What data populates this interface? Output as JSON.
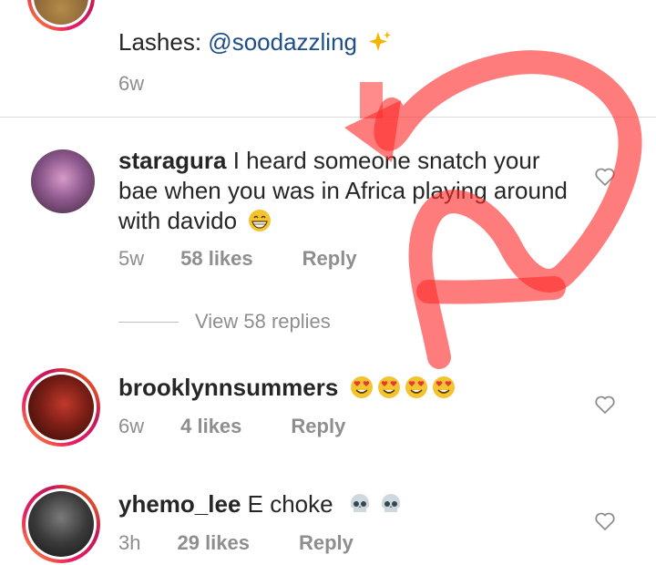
{
  "comments": [
    {
      "text_prefix": "Lashes: ",
      "mention": "@soodazzling",
      "time": "6w"
    },
    {
      "username": "staragura",
      "text": " I heard someone snatch your bae when you was in Africa playing around with davido",
      "time": "5w",
      "likes": "58 likes",
      "reply": "Reply",
      "view_replies": "View 58 replies"
    },
    {
      "username": "brooklynnsummers",
      "text": "",
      "time": "6w",
      "likes": "4 likes",
      "reply": "Reply"
    },
    {
      "username": "yhemo_lee",
      "text": " E choke",
      "time": "3h",
      "likes": "29 likes",
      "reply": "Reply"
    }
  ],
  "colors": {
    "mention": "#1d4d8a",
    "meta": "#8e8e8e",
    "annotation": "#ff3b3b"
  },
  "icons": {
    "like": "heart-outline-icon",
    "sparkle": "sparkles-emoji",
    "grin": "grinning-emoji",
    "hearts": "heart-eyes-emoji",
    "skull": "skull-emoji"
  }
}
